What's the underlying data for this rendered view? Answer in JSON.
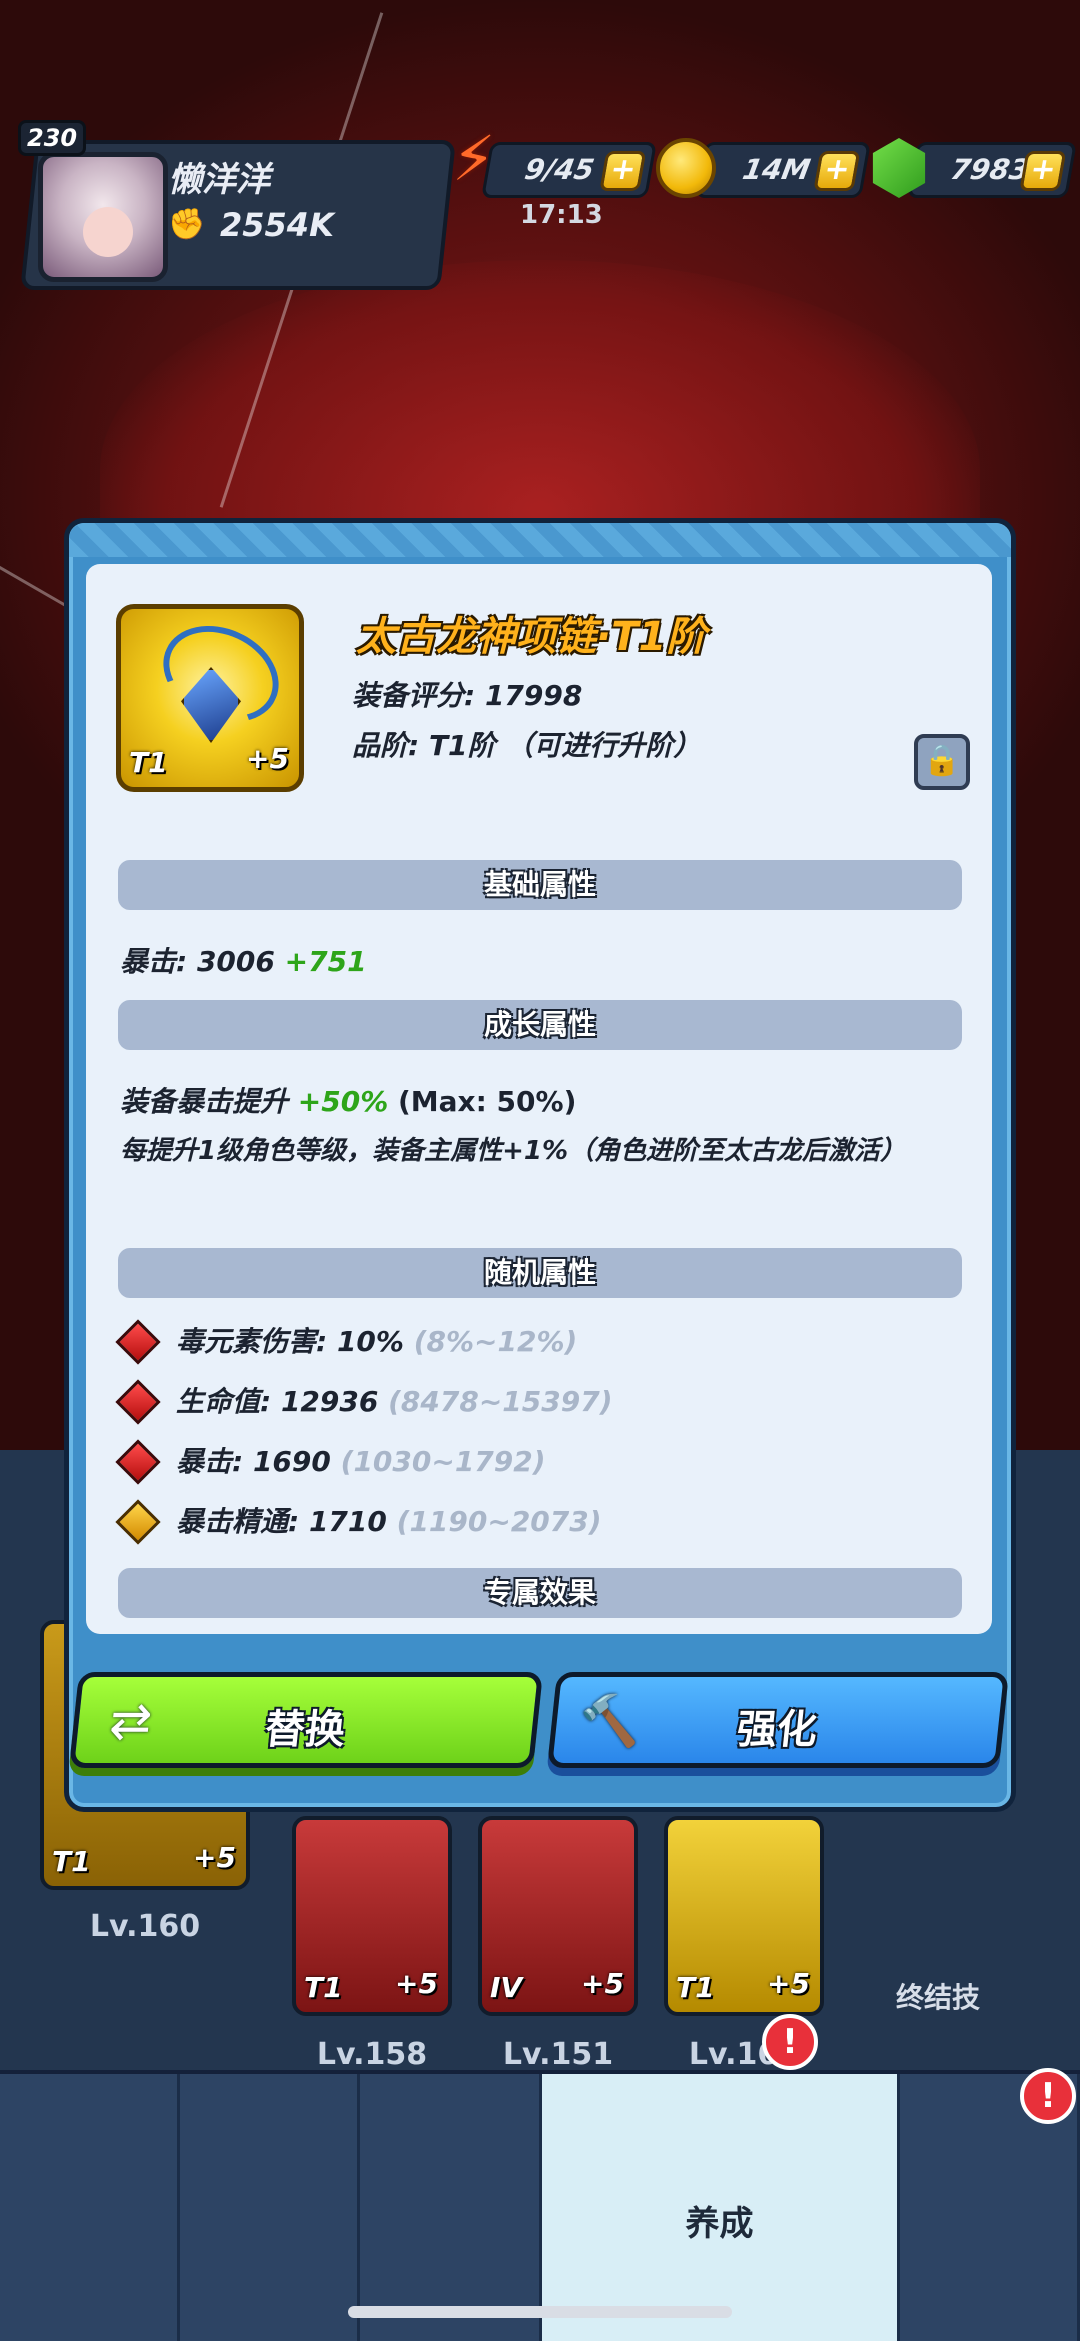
{
  "hud": {
    "player_level": "230",
    "player_name": "懒洋洋",
    "combat_power": "2554K",
    "energy": "9/45",
    "energy_timer": "17:13",
    "coins": "14M",
    "gems": "7983",
    "plus_label": "+"
  },
  "item": {
    "name": "太古龙神项链·T1阶",
    "score": "装备评分: 17998",
    "grade": "品阶: T1阶 （可进行升阶）",
    "tier_badge": "T1",
    "enhance_badge": "+5"
  },
  "sections": {
    "base": "基础属性",
    "growth": "成长属性",
    "random": "随机属性",
    "exclusive": "专属效果"
  },
  "base_stat": {
    "label": "暴击: 3006",
    "bonus": "+751"
  },
  "growth_stats": {
    "line1_prefix": "装备暴击提升",
    "line1_value": "+50%",
    "line1_suffix": "(Max: 50%)",
    "line2": "每提升1级角色等级，装备主属性+1%（角色进阶至太古龙后激活）"
  },
  "random_stats": [
    {
      "text": "毒元素伤害: 10%",
      "range": "(8%~12%)",
      "color": "red"
    },
    {
      "text": "生命值: 12936",
      "range": "(8478~15397)",
      "color": "red"
    },
    {
      "text": "暴击: 1690",
      "range": "(1030~1792)",
      "color": "red"
    },
    {
      "text": "暴击精通: 1710",
      "range": "(1190~2073)",
      "color": "gold"
    }
  ],
  "buttons": {
    "replace": "替换",
    "enhance": "强化"
  },
  "background": {
    "slots": [
      {
        "tier": "T1",
        "plus": "+5",
        "level": "Lv.160"
      },
      {
        "tier": "T1",
        "plus": "+5",
        "level": "Lv.158"
      },
      {
        "tier": "IV",
        "plus": "+5",
        "level": "Lv.151"
      },
      {
        "tier": "T1",
        "plus": "+5",
        "level": "Lv.160"
      }
    ],
    "ultimate_label": "终结技",
    "tab_active_label": "养成",
    "badge": "!"
  },
  "colors": {
    "accent_gold": "#ffb21c",
    "stat_green": "#2ea51a",
    "button_green": "#8be32a",
    "button_blue": "#3b9af5"
  }
}
